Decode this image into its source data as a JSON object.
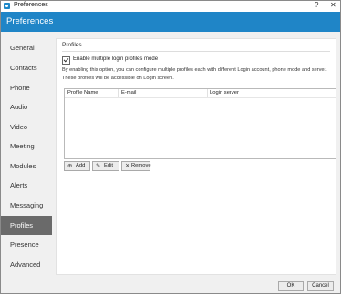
{
  "window": {
    "title": "Preferences",
    "help_glyph": "?",
    "close_glyph": "✕"
  },
  "header": {
    "title": "Preferences"
  },
  "sidebar": {
    "items": [
      {
        "label": "General"
      },
      {
        "label": "Contacts"
      },
      {
        "label": "Phone"
      },
      {
        "label": "Audio"
      },
      {
        "label": "Video"
      },
      {
        "label": "Meeting"
      },
      {
        "label": "Modules"
      },
      {
        "label": "Alerts"
      },
      {
        "label": "Messaging"
      },
      {
        "label": "Profiles",
        "active": true
      },
      {
        "label": "Presence"
      },
      {
        "label": "Advanced"
      }
    ]
  },
  "profiles": {
    "section_title": "Profiles",
    "enable_checkbox": {
      "label": "Enable multiple login profiles mode",
      "checked": true
    },
    "description_line1": "By enabling this option, you can configure multiple profiles each with different Login account, phone mode and server.",
    "description_line2": "These profiles will be accessible on Login screen.",
    "table": {
      "columns": [
        "Profile Name",
        "E-mail",
        "Login server"
      ],
      "rows": []
    },
    "buttons": {
      "add": {
        "label": "Add",
        "icon": "add-user-icon"
      },
      "edit": {
        "label": "Edit",
        "icon": "pencil-icon"
      },
      "remove": {
        "label": "Remove",
        "icon": "close-icon"
      }
    }
  },
  "footer": {
    "ok": "OK",
    "cancel": "Cancel"
  },
  "colors": {
    "accent": "#1f85c7",
    "active_nav": "#6a6a6a",
    "sidebar_bg": "#f0f0f0"
  }
}
